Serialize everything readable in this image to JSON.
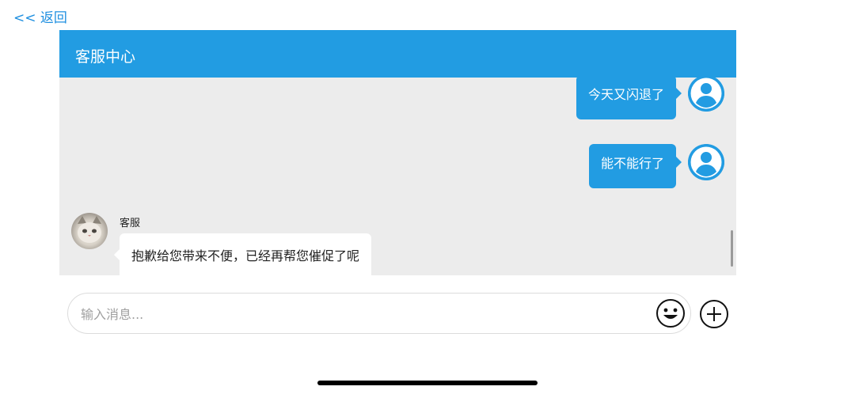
{
  "nav": {
    "back_label": "<< 返回"
  },
  "header": {
    "title": "客服中心"
  },
  "messages": [
    {
      "sender": "user",
      "text": "今天又闪退了"
    },
    {
      "sender": "user",
      "text": "能不能行了"
    },
    {
      "sender": "agent",
      "name": "客服",
      "text": "抱歉给您带来不便，已经再帮您催促了呢"
    }
  ],
  "composer": {
    "placeholder": "输入消息..."
  },
  "icons": {
    "user_avatar": "person-avatar-icon",
    "agent_avatar": "cat-photo-avatar",
    "emoji": "smiley-face-icon",
    "plus": "plus-circle-icon"
  },
  "colors": {
    "accent": "#229ce2",
    "chat_background": "#ececec",
    "back_link": "#1e8fe0"
  }
}
